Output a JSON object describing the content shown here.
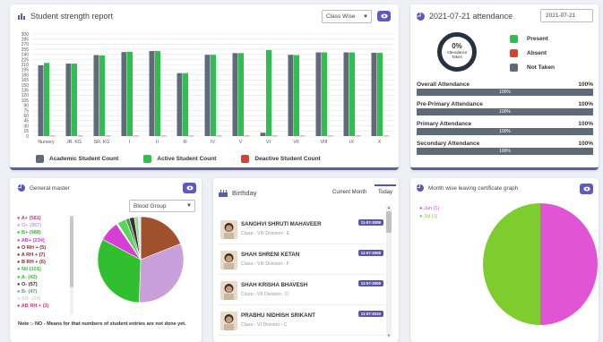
{
  "strength": {
    "title": "Student strength report",
    "select_value": "Class Wise",
    "legend": {
      "academic": "Academic Student Count",
      "active": "Active Student Count",
      "deactive": "Deactive Student Count"
    },
    "colors": {
      "academic": "#5f6b78",
      "active": "#2fbf4f",
      "deactive": "#d9412f"
    }
  },
  "chart_data": {
    "type": "bar",
    "categories": [
      "Nursery",
      "JR. KG",
      "SR. KG",
      "I",
      "II",
      "III",
      "IV",
      "V",
      "VI",
      "VII",
      "VIII",
      "IX",
      "X"
    ],
    "series": [
      {
        "name": "Academic Student Count",
        "values": [
          208,
          213,
          238,
          247,
          250,
          185,
          239,
          244,
          10,
          239,
          246,
          246,
          245
        ]
      },
      {
        "name": "Active Student Count",
        "values": [
          215,
          213,
          237,
          248,
          250,
          185,
          239,
          244,
          253,
          238,
          246,
          246,
          245
        ]
      },
      {
        "name": "Deactive Student Count",
        "values": [
          1,
          1,
          1,
          1,
          1,
          1,
          1,
          1,
          1,
          1,
          1,
          1,
          1
        ]
      }
    ],
    "yticks": [
      "0",
      "15",
      "30",
      "45",
      "60",
      "75",
      "90",
      "105",
      "120",
      "135",
      "150",
      "165",
      "180",
      "195",
      "210",
      "225",
      "240",
      "255",
      "270",
      "285",
      "300"
    ],
    "ylim": [
      0,
      300
    ]
  },
  "attendance": {
    "title": "2021-07-21 attendance",
    "date_value": "2021-07-21",
    "donut_percent": "0%",
    "donut_label1": "Attendance",
    "donut_label2": "Taken",
    "legend": {
      "present": "Present",
      "absent": "Absent",
      "not_taken": "Not Taken"
    },
    "bars": [
      {
        "label": "Overall Attendance",
        "percent": "100%",
        "inner": "100%"
      },
      {
        "label": "Pre-Primary Attendance",
        "percent": "100%",
        "inner": "100%"
      },
      {
        "label": "Primary Attendance",
        "percent": "100%",
        "inner": "100%"
      },
      {
        "label": "Secondary Attendance",
        "percent": "100%",
        "inner": "100%"
      }
    ]
  },
  "general_master": {
    "title": "General master",
    "select_value": "Blood Group",
    "list": [
      {
        "text": "A+ (581)",
        "color": "#d63384"
      },
      {
        "text": "O+ (967)",
        "color": "#c9a0c9"
      },
      {
        "text": "B+ (988)",
        "color": "#2fbf2f"
      },
      {
        "text": "AB+ (234)",
        "color": "#c93fc9"
      },
      {
        "text": "O RH + (5)",
        "color": "#8a2b2b"
      },
      {
        "text": "A RH + (7)",
        "color": "#8a2b2b"
      },
      {
        "text": "B RH + (6)",
        "color": "#8a2b2b"
      },
      {
        "text": "Nil (101)",
        "color": "#2fbf2f"
      },
      {
        "text": "A- (42)",
        "color": "#2fbf2f"
      },
      {
        "text": "O- (57)",
        "color": "#333333"
      },
      {
        "text": "B- (47)",
        "color": "#5fa05f"
      },
      {
        "text": "AB- (24)",
        "color": "#d5d5d5"
      },
      {
        "text": "AB RH + (3)",
        "color": "#d63384"
      }
    ],
    "note": "Note :- NO - Means for that numbers of student entries are not done yet."
  },
  "birthday": {
    "title": "Birthday",
    "tabs": [
      "Current Month",
      "Today"
    ],
    "items": [
      {
        "name": "SANGHVI SHRUTI MAHAVEER",
        "class": "Class:- VIII Division:- E",
        "date": "11-07-2008"
      },
      {
        "name": "SHAH SHRENI KETAN",
        "class": "Class:- VIII Division:- F",
        "date": "11-07-2008"
      },
      {
        "name": "SHAH KRISHA BHAVESH",
        "class": "Class:- VII Division:- D",
        "date": "11-07-2009"
      },
      {
        "name": "PRABHU NIDHISH SRIKANT",
        "class": "Class:- VI Division:- C",
        "date": "11-07-2010"
      }
    ]
  },
  "leaving": {
    "title": "Month wise leaving certificate graph",
    "legend": [
      {
        "text": "Jun (1)",
        "color": "#d63fd6"
      },
      {
        "text": "Jul (1)",
        "color": "#7fcc2f"
      }
    ]
  }
}
